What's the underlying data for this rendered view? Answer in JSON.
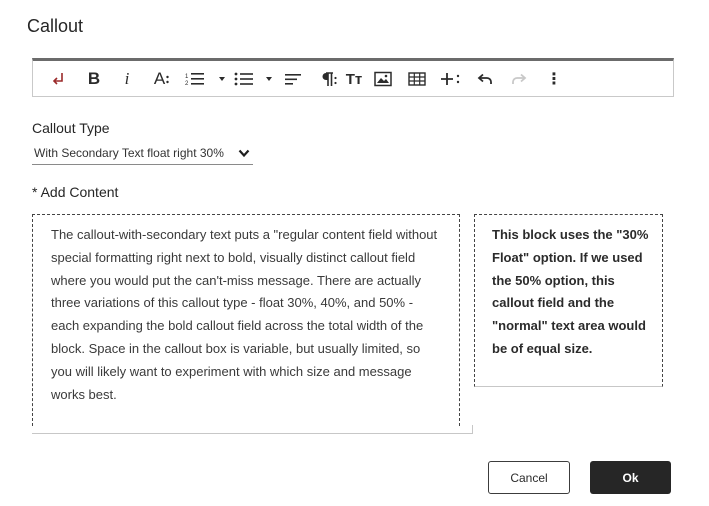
{
  "dialog": {
    "title": "Callout"
  },
  "toolbar": {
    "bold": "B",
    "italic": "i",
    "font_size": "A",
    "heading": "Tт",
    "more": "⋮"
  },
  "form": {
    "callout_type_label": "Callout Type",
    "callout_type_value": "With Secondary Text float right 30%",
    "add_content_label": "* Add Content",
    "main_text": "The callout-with-secondary text puts a \"regular content field without special formatting right next to bold, visually distinct callout field where you would put the can't-miss message. There are actually three variations of this callout type - float 30%, 40%, and 50% - each expanding the bold callout field across the total width of the block. Space in the callout box is variable, but usually limited, so you will likely want to experiment with which size and message works best.",
    "callout_text": "This block uses the \"30% Float\" option. If we used the 50% option, this callout field and the \"normal\" text area would be of equal size."
  },
  "buttons": {
    "cancel": "Cancel",
    "ok": "Ok"
  },
  "colors": {
    "accent": "#9b2a2a",
    "primary_button": "#262626"
  }
}
